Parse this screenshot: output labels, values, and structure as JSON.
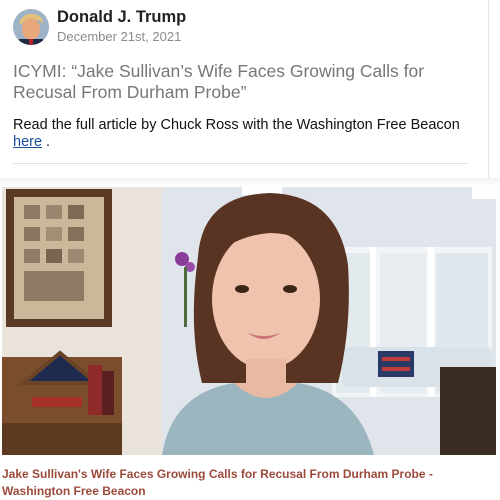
{
  "post": {
    "author": "Donald J. Trump",
    "date": "December 21st, 2021",
    "headline": "ICYMI: “Jake Sullivan’s Wife Faces Growing Calls for Recusal From Durham Probe”",
    "body_prefix": "Read the full article by Chuck Ross with the Washington Free Beacon",
    "link_text": "here",
    "body_suffix": " ."
  },
  "media": {
    "caption_line1": "Jake Sullivan's Wife Faces Growing Calls for Recusal From Durham Probe -",
    "caption_line2": "Washington Free Beacon"
  },
  "colors": {
    "link": "#1a4fa0",
    "caption": "#9c4a3b",
    "headline": "#777777"
  }
}
